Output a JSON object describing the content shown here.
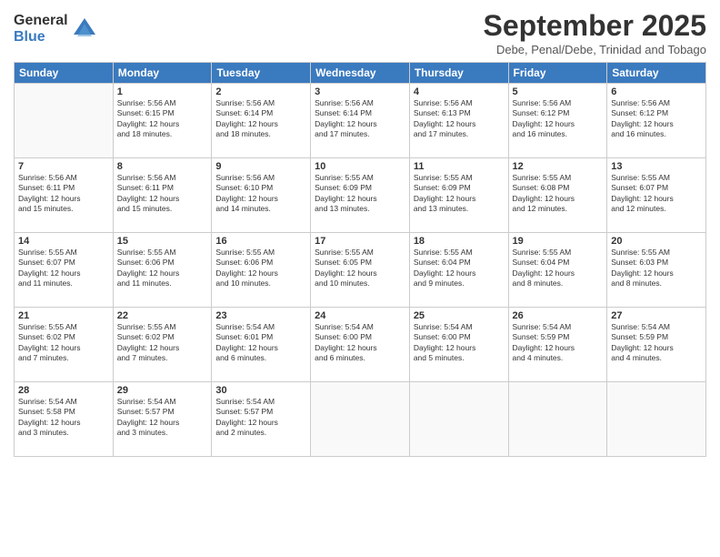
{
  "logo": {
    "general": "General",
    "blue": "Blue"
  },
  "title": "September 2025",
  "subtitle": "Debe, Penal/Debe, Trinidad and Tobago",
  "days_header": [
    "Sunday",
    "Monday",
    "Tuesday",
    "Wednesday",
    "Thursday",
    "Friday",
    "Saturday"
  ],
  "weeks": [
    [
      {
        "day": "",
        "info": ""
      },
      {
        "day": "1",
        "info": "Sunrise: 5:56 AM\nSunset: 6:15 PM\nDaylight: 12 hours\nand 18 minutes."
      },
      {
        "day": "2",
        "info": "Sunrise: 5:56 AM\nSunset: 6:14 PM\nDaylight: 12 hours\nand 18 minutes."
      },
      {
        "day": "3",
        "info": "Sunrise: 5:56 AM\nSunset: 6:14 PM\nDaylight: 12 hours\nand 17 minutes."
      },
      {
        "day": "4",
        "info": "Sunrise: 5:56 AM\nSunset: 6:13 PM\nDaylight: 12 hours\nand 17 minutes."
      },
      {
        "day": "5",
        "info": "Sunrise: 5:56 AM\nSunset: 6:12 PM\nDaylight: 12 hours\nand 16 minutes."
      },
      {
        "day": "6",
        "info": "Sunrise: 5:56 AM\nSunset: 6:12 PM\nDaylight: 12 hours\nand 16 minutes."
      }
    ],
    [
      {
        "day": "7",
        "info": "Sunrise: 5:56 AM\nSunset: 6:11 PM\nDaylight: 12 hours\nand 15 minutes."
      },
      {
        "day": "8",
        "info": "Sunrise: 5:56 AM\nSunset: 6:11 PM\nDaylight: 12 hours\nand 15 minutes."
      },
      {
        "day": "9",
        "info": "Sunrise: 5:56 AM\nSunset: 6:10 PM\nDaylight: 12 hours\nand 14 minutes."
      },
      {
        "day": "10",
        "info": "Sunrise: 5:55 AM\nSunset: 6:09 PM\nDaylight: 12 hours\nand 13 minutes."
      },
      {
        "day": "11",
        "info": "Sunrise: 5:55 AM\nSunset: 6:09 PM\nDaylight: 12 hours\nand 13 minutes."
      },
      {
        "day": "12",
        "info": "Sunrise: 5:55 AM\nSunset: 6:08 PM\nDaylight: 12 hours\nand 12 minutes."
      },
      {
        "day": "13",
        "info": "Sunrise: 5:55 AM\nSunset: 6:07 PM\nDaylight: 12 hours\nand 12 minutes."
      }
    ],
    [
      {
        "day": "14",
        "info": "Sunrise: 5:55 AM\nSunset: 6:07 PM\nDaylight: 12 hours\nand 11 minutes."
      },
      {
        "day": "15",
        "info": "Sunrise: 5:55 AM\nSunset: 6:06 PM\nDaylight: 12 hours\nand 11 minutes."
      },
      {
        "day": "16",
        "info": "Sunrise: 5:55 AM\nSunset: 6:06 PM\nDaylight: 12 hours\nand 10 minutes."
      },
      {
        "day": "17",
        "info": "Sunrise: 5:55 AM\nSunset: 6:05 PM\nDaylight: 12 hours\nand 10 minutes."
      },
      {
        "day": "18",
        "info": "Sunrise: 5:55 AM\nSunset: 6:04 PM\nDaylight: 12 hours\nand 9 minutes."
      },
      {
        "day": "19",
        "info": "Sunrise: 5:55 AM\nSunset: 6:04 PM\nDaylight: 12 hours\nand 8 minutes."
      },
      {
        "day": "20",
        "info": "Sunrise: 5:55 AM\nSunset: 6:03 PM\nDaylight: 12 hours\nand 8 minutes."
      }
    ],
    [
      {
        "day": "21",
        "info": "Sunrise: 5:55 AM\nSunset: 6:02 PM\nDaylight: 12 hours\nand 7 minutes."
      },
      {
        "day": "22",
        "info": "Sunrise: 5:55 AM\nSunset: 6:02 PM\nDaylight: 12 hours\nand 7 minutes."
      },
      {
        "day": "23",
        "info": "Sunrise: 5:54 AM\nSunset: 6:01 PM\nDaylight: 12 hours\nand 6 minutes."
      },
      {
        "day": "24",
        "info": "Sunrise: 5:54 AM\nSunset: 6:00 PM\nDaylight: 12 hours\nand 6 minutes."
      },
      {
        "day": "25",
        "info": "Sunrise: 5:54 AM\nSunset: 6:00 PM\nDaylight: 12 hours\nand 5 minutes."
      },
      {
        "day": "26",
        "info": "Sunrise: 5:54 AM\nSunset: 5:59 PM\nDaylight: 12 hours\nand 4 minutes."
      },
      {
        "day": "27",
        "info": "Sunrise: 5:54 AM\nSunset: 5:59 PM\nDaylight: 12 hours\nand 4 minutes."
      }
    ],
    [
      {
        "day": "28",
        "info": "Sunrise: 5:54 AM\nSunset: 5:58 PM\nDaylight: 12 hours\nand 3 minutes."
      },
      {
        "day": "29",
        "info": "Sunrise: 5:54 AM\nSunset: 5:57 PM\nDaylight: 12 hours\nand 3 minutes."
      },
      {
        "day": "30",
        "info": "Sunrise: 5:54 AM\nSunset: 5:57 PM\nDaylight: 12 hours\nand 2 minutes."
      },
      {
        "day": "",
        "info": ""
      },
      {
        "day": "",
        "info": ""
      },
      {
        "day": "",
        "info": ""
      },
      {
        "day": "",
        "info": ""
      }
    ]
  ]
}
